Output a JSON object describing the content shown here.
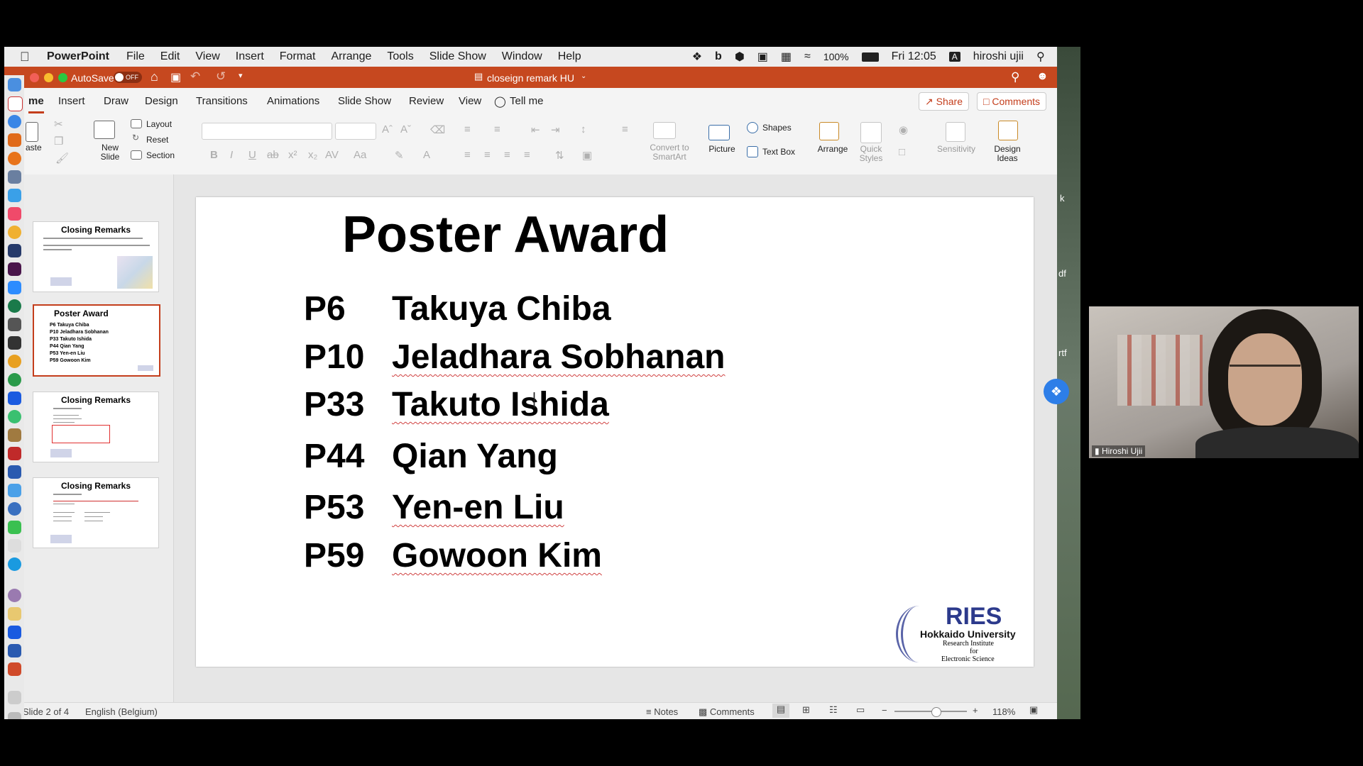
{
  "menubar": {
    "app": "PowerPoint",
    "items": [
      "File",
      "Edit",
      "View",
      "Insert",
      "Format",
      "Arrange",
      "Tools",
      "Slide Show",
      "Window",
      "Help"
    ],
    "battery": "100%",
    "clock": "Fri 12:05",
    "user": "hiroshi ujii",
    "input_badge": "A"
  },
  "titlebar": {
    "autosave": "AutoSave",
    "autosave_state": "OFF",
    "doc_title": "closeign remark HU"
  },
  "tabs": {
    "items": [
      "me",
      "Insert",
      "Draw",
      "Design",
      "Transitions",
      "Animations",
      "Slide Show",
      "Review",
      "View",
      "Tell me"
    ],
    "share": "Share",
    "comments": "Comments"
  },
  "ribbon": {
    "paste": "aste",
    "new_slide": "New Slide",
    "layout": "Layout",
    "reset": "Reset",
    "section": "Section",
    "convert": "Convert to SmartArt",
    "picture": "Picture",
    "shapes": "Shapes",
    "text_box": "Text Box",
    "arrange": "Arrange",
    "quick_styles": "Quick Styles",
    "sensitivity": "Sensitivity",
    "design_ideas": "Design Ideas"
  },
  "thumbnails": [
    {
      "title": "Closing Remarks"
    },
    {
      "title": "Poster Award",
      "names": [
        "P6    Takuya Chiba",
        "P10  Jeladhara Sobhanan",
        "P33  Takuto Ishida",
        "P44  Qian Yang",
        "P53  Yen-en Liu",
        "P59  Gowoon Kim"
      ]
    },
    {
      "title": "Closing Remarks"
    },
    {
      "title": "Closing Remarks"
    }
  ],
  "slide": {
    "title": "Poster Award",
    "rows": [
      {
        "code": "P6",
        "name": "Takuya Chiba"
      },
      {
        "code": "P10",
        "name": "Jeladhara Sobhanan"
      },
      {
        "code": "P33",
        "name": "Takuto Ishida"
      },
      {
        "code": "P44",
        "name": "Qian Yang"
      },
      {
        "code": "P53",
        "name": "Yen-en Liu"
      },
      {
        "code": "P59",
        "name": "Gowoon Kim"
      }
    ],
    "logo": {
      "abbr": "RIES",
      "university": "Hokkaido University",
      "line1": "Research Institute",
      "line2": "for",
      "line3": "Electronic Science"
    }
  },
  "statusbar": {
    "slide_info": "Slide 2 of 4",
    "language": "English (Belgium)",
    "notes": "Notes",
    "comments": "Comments",
    "zoom": "118%"
  },
  "video": {
    "participant": "Hiroshi Ujii"
  },
  "side_letters": [
    "k",
    "df",
    "rtf"
  ]
}
